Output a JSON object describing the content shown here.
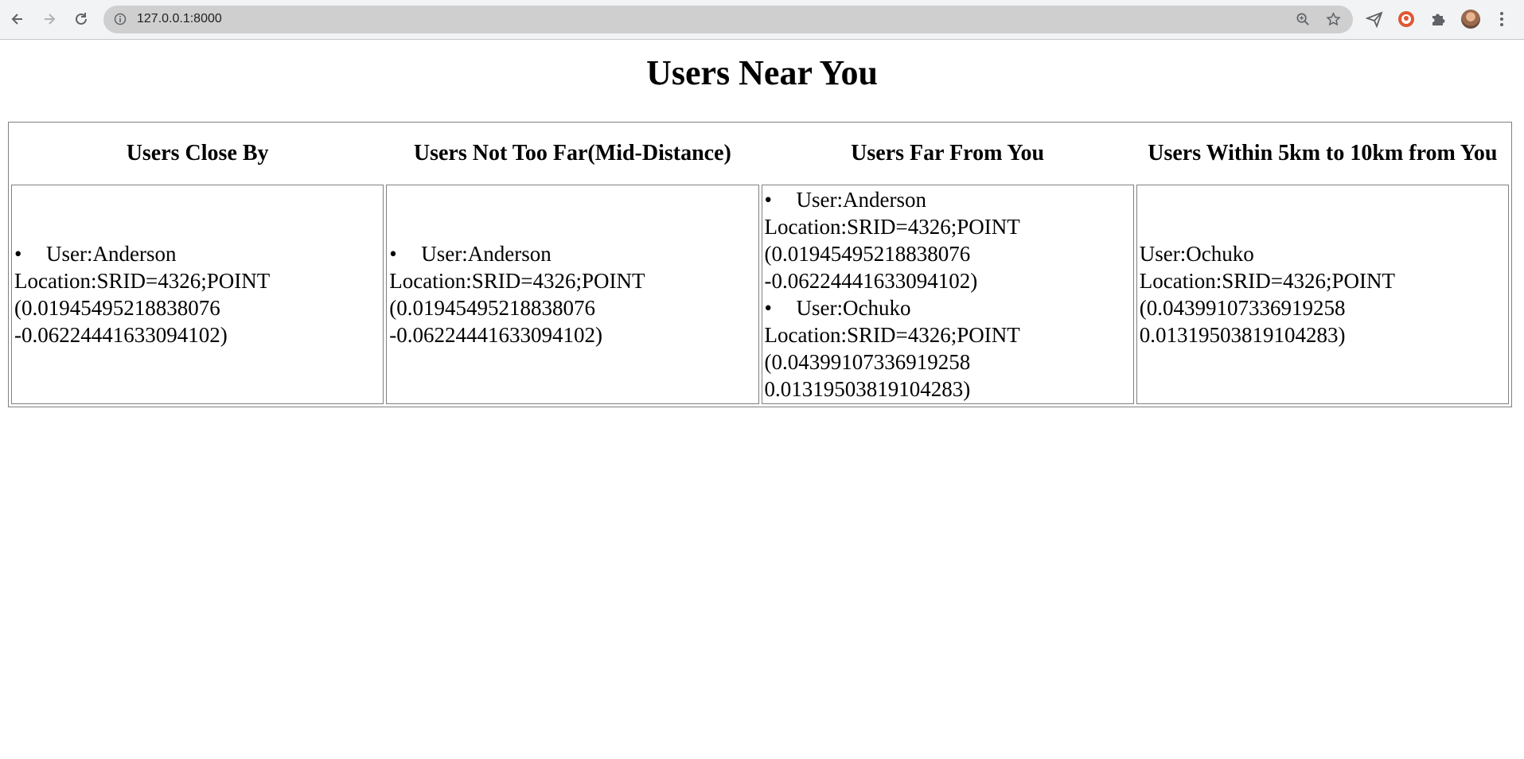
{
  "browser": {
    "url": "127.0.0.1:8000"
  },
  "page": {
    "title": "Users Near You",
    "columns": [
      {
        "header": "Users Close By",
        "entries": [
          {
            "user": "User:Anderson",
            "location": "Location:SRID=4326;POINT",
            "coord1": "(0.01945495218838076",
            "coord2": "-0.06224441633094102)"
          }
        ]
      },
      {
        "header": "Users Not Too Far(Mid-Distance)",
        "entries": [
          {
            "user": "User:Anderson",
            "location": "Location:SRID=4326;POINT",
            "coord1": "(0.01945495218838076",
            "coord2": "-0.06224441633094102)"
          }
        ]
      },
      {
        "header": "Users Far From You",
        "entries": [
          {
            "user": "User:Anderson",
            "location": "Location:SRID=4326;POINT",
            "coord1": "(0.01945495218838076",
            "coord2": "-0.06224441633094102)"
          },
          {
            "user": "User:Ochuko",
            "location": "Location:SRID=4326;POINT",
            "coord1": "(0.04399107336919258",
            "coord2": "0.01319503819104283)"
          }
        ]
      },
      {
        "header": "Users Within 5km to 10km from You",
        "entries": [
          {
            "user": "User:Ochuko",
            "location": "Location:SRID=4326;POINT",
            "coord1": "(0.04399107336919258",
            "coord2": "0.01319503819104283)"
          }
        ]
      }
    ]
  }
}
